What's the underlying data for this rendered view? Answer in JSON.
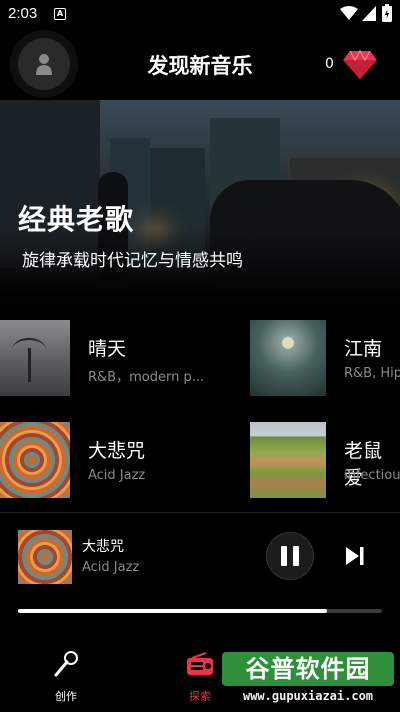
{
  "status_bar": {
    "time": "2:03",
    "notification_letter": "A"
  },
  "header": {
    "title": "发现新音乐",
    "gem_count": "0"
  },
  "banner": {
    "title": "经典老歌",
    "subtitle": "旋律承载时代记忆与情感共鸣"
  },
  "songs": [
    {
      "title": "晴天",
      "subtitle": "R&B，modern p..."
    },
    {
      "title": "江南",
      "subtitle": "R&B, Hip"
    },
    {
      "title": "大悲咒",
      "subtitle": "Acid Jazz"
    },
    {
      "title": "老鼠爱",
      "subtitle": "infectiou"
    }
  ],
  "now_playing": {
    "title": "大悲咒",
    "subtitle": "Acid Jazz",
    "progress": 0.85
  },
  "nav": {
    "create": "创作",
    "explore": "探索"
  },
  "watermark": {
    "top": "谷普软件园",
    "bottom": "www.gupuxiazai.com"
  },
  "colors": {
    "accent": "#e8334a",
    "watermark_green": "#2f8f3a"
  },
  "icons": [
    "signal-icon",
    "battery-icon",
    "person-icon",
    "gem-icon",
    "pause-icon",
    "skip-next-icon",
    "microphone-icon",
    "radio-icon"
  ]
}
